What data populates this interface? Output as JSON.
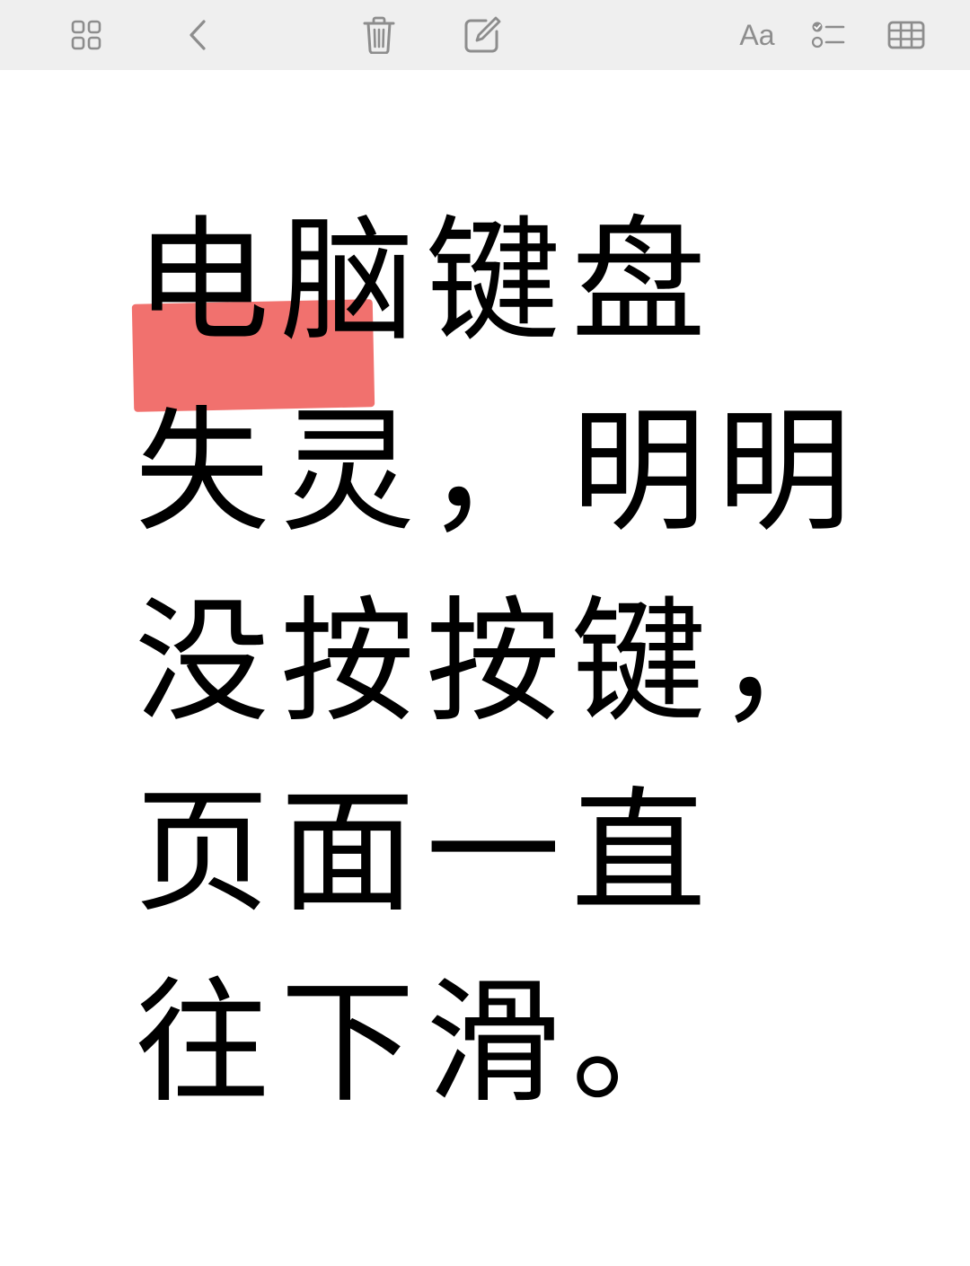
{
  "toolbar": {
    "font_button_label": "Aa",
    "icons": [
      "gallery-grid-icon",
      "back-chevron-icon",
      "trash-icon",
      "compose-icon",
      "font-format-icon",
      "checklist-icon",
      "table-icon"
    ],
    "icon_color": "#8d8d8d",
    "background": "#efefef"
  },
  "note": {
    "lines": [
      "电脑键盘",
      "失灵，明明",
      "没按按键，",
      "页面一直",
      "往下滑。"
    ],
    "highlight_color": "#f16e6b",
    "highlighted_text": "电脑"
  }
}
